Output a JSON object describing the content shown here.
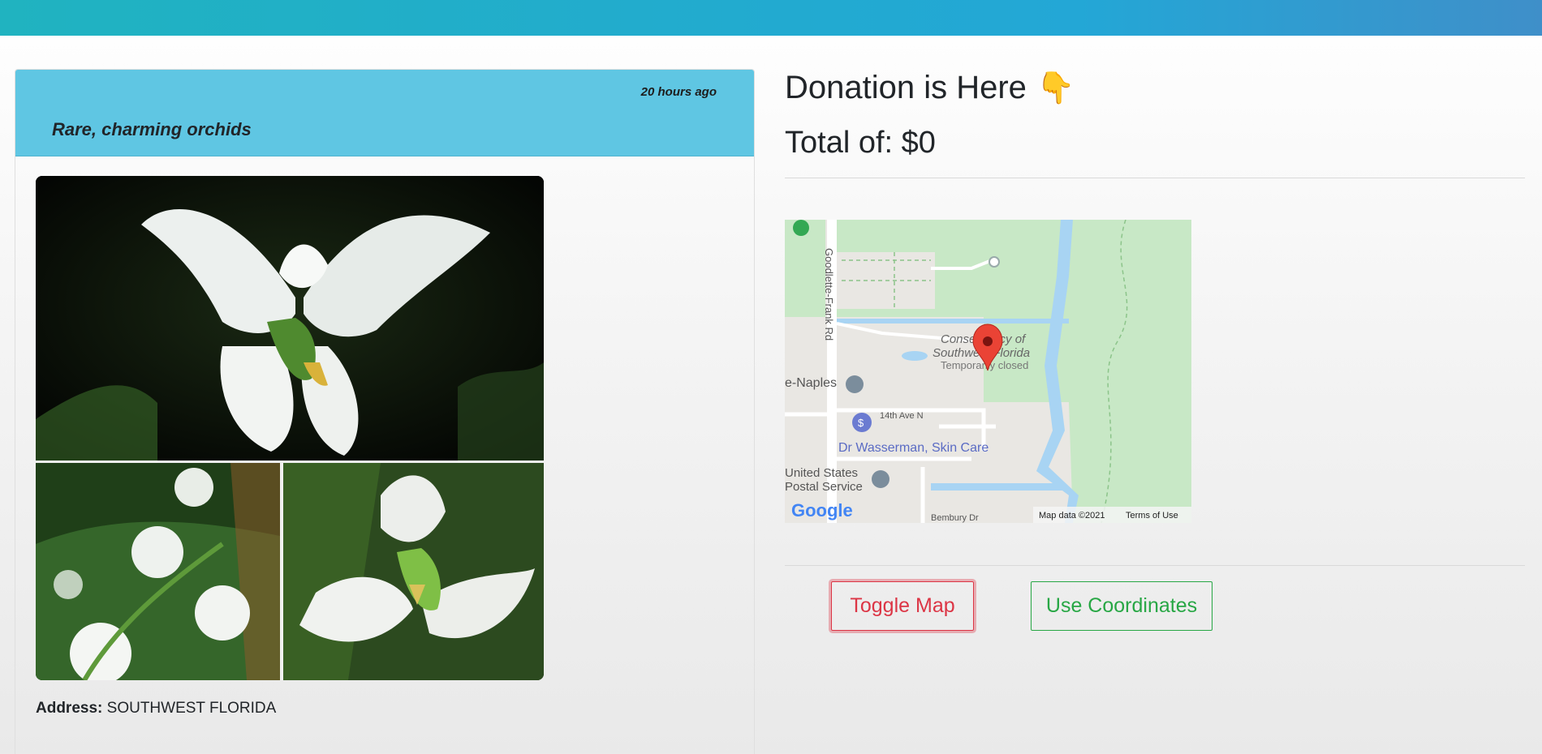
{
  "post": {
    "time_ago": "20 hours ago",
    "title": "Rare, charming orchids",
    "address_label": "Address:",
    "address_value": "SOUTHWEST FLORIDA"
  },
  "donation": {
    "heading": "Donation is Here",
    "heading_emoji": "👇",
    "total": "Total of: $0"
  },
  "map": {
    "road_goodlette": "Goodlette-Frank Rd",
    "place_name_1": "Conservancy of",
    "place_name_2": "Southwest Florida",
    "place_status": "Temporarily closed",
    "naples": "e-Naples",
    "street_14th": "14th Ave N",
    "wasserman": "Dr Wasserman, Skin Care",
    "usps_1": "United States",
    "usps_2": "Postal Service",
    "bembury": "Bembury Dr",
    "google_logo": "Google",
    "map_data": "Map data ©2021",
    "terms": "Terms of Use"
  },
  "buttons": {
    "toggle_map": "Toggle Map",
    "use_coordinates": "Use Coordinates"
  },
  "colors": {
    "header_bar": "#23a7d6",
    "card_header": "#5fc6e3",
    "toggle_btn": "#dc3545",
    "coords_btn": "#28a745"
  },
  "icons": {
    "emoji": "pointing-down-emoji",
    "map_pin": "map-pin-icon"
  }
}
